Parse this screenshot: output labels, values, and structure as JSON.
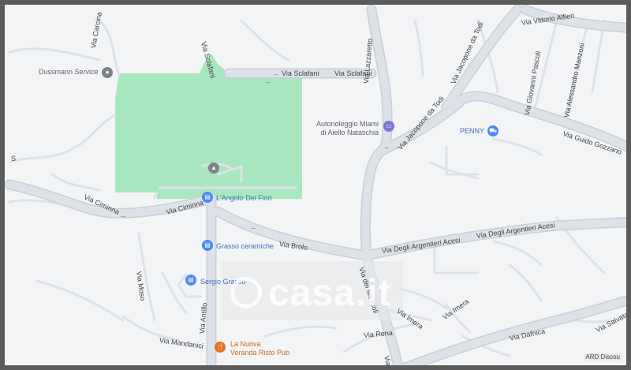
{
  "map": {
    "streets": {
      "via_sclafani_vertical": "Via Sclafani",
      "via_sclafani_h1": "Via Sclafani",
      "via_sclafani_h2": "Via Sclafani",
      "via_carcina": "Via Carcina",
      "via_lazzaretto": "Via Lazzaretto",
      "via_jacopone_top": "Via Jacopone da Todi",
      "via_jacopone_low": "Via Jacopone da Todi",
      "via_vittorio_alfieri": "Via Vittorio Alfieri",
      "via_giovanni_pascoli": "Via Giovanni Pascoli",
      "via_alessandro_manzoni": "Via Alessandro Manzoni",
      "via_guido_gozzano": "Via Guido Gozzano",
      "via_ciminna_1": "Via Ciminna",
      "via_ciminna_2": "Via Ciminna",
      "via_brolo": "Via Brolo",
      "via_argentieri_1": "Via Degli Argentieri Acesi",
      "via_argentieri_2": "Via Degli Argentieri Acesi",
      "via_dei_miracoli": "Via dei Miracoli",
      "via_moso": "Via Moso",
      "via_antillo": "Via Antillo",
      "via_mandanici": "Via Mandanici",
      "via_rena": "Via Rena",
      "via_imera_1": "Via Imera",
      "via_imera_2": "Via Imera",
      "via_dafnica": "Via Dafnica",
      "via_salvatore": "Via Salvatore",
      "via_dei_m": "Via dei M"
    },
    "pois": {
      "dussmann": "Dussmann Service",
      "autonoleggio_line1": "Autonoleggio Miami",
      "autonoleggio_line2": "di Aiello Nataschia",
      "penny": "PENNY",
      "angolo_fiori": "L'Angolo Dei Fiori",
      "grasso_ceramiche": "Grasso ceramiche",
      "sergio_grasso": "Sergio Grasso",
      "nuova_veranda_line1": "La Nuova",
      "nuova_veranda_line2": "Veranda Risto Pub"
    },
    "left_edge_label": "S",
    "watermark": "casa.it",
    "attribution": "ARD Discou"
  },
  "colors": {
    "background": "#f3f4f6",
    "road": "#dde2e8",
    "road_border": "#c9cfd6",
    "park": "#a8e6bd",
    "frame": "#5b5b5b",
    "poi_blue": "#3b6fb3",
    "poi_orange": "#c96a1b"
  },
  "icons": {
    "dussmann": "place-icon",
    "autonoleggio": "car-icon",
    "penny": "cart-icon",
    "angolo_fiori": "shop-icon",
    "grasso_ceramiche": "shop-icon",
    "sergio_grasso": "shop-icon",
    "nuova_veranda": "restaurant-icon",
    "park": "landmark-icon"
  }
}
